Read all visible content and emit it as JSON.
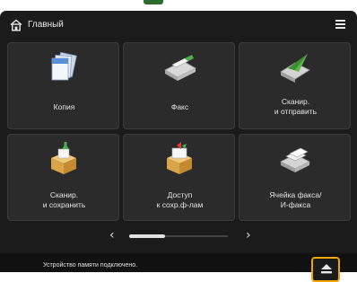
{
  "header": {
    "title": "Главный",
    "home_icon": "home-icon",
    "menu_icon": "hamburger-menu-icon"
  },
  "tiles": [
    {
      "label": "Копия",
      "icon": "copy-icon"
    },
    {
      "label": "Факс",
      "icon": "fax-icon"
    },
    {
      "label": "Сканир.\nи отправить",
      "icon": "scan-and-send-icon"
    },
    {
      "label": "Сканир.\nи сохранить",
      "icon": "scan-and-store-icon"
    },
    {
      "label": "Доступ\nк сохр.ф-лам",
      "icon": "access-stored-files-icon"
    },
    {
      "label": "Ячейка факса/\nИ-факса",
      "icon": "fax-inbox-icon"
    }
  ],
  "pager": {
    "prev_label": "‹",
    "next_label": "›",
    "page": 1,
    "pages": 3
  },
  "status": {
    "message": "Устройство памяти подключено.",
    "eject_icon": "eject-icon"
  },
  "colors": {
    "background": "#1b1b1b",
    "tile": "#2b2b2b",
    "accent": "#f2a400",
    "green": "#2e6b2e"
  }
}
